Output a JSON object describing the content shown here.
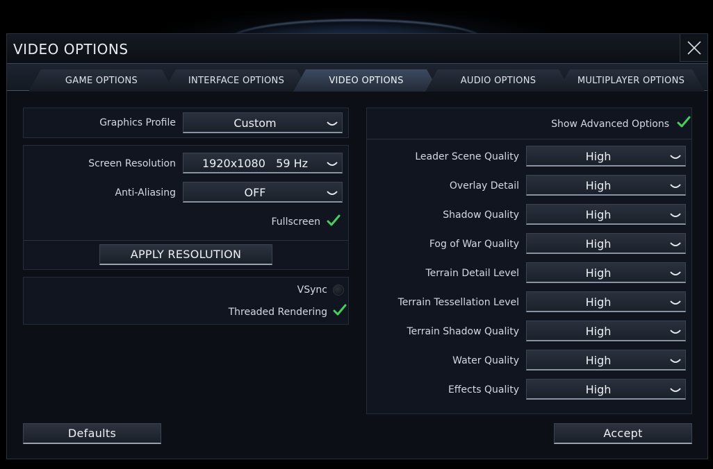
{
  "window": {
    "title": "VIDEO OPTIONS"
  },
  "tabs": [
    {
      "label": "GAME OPTIONS",
      "active": false
    },
    {
      "label": "INTERFACE OPTIONS",
      "active": false
    },
    {
      "label": "VIDEO OPTIONS",
      "active": true
    },
    {
      "label": "AUDIO OPTIONS",
      "active": false
    },
    {
      "label": "MULTIPLAYER OPTIONS",
      "active": false
    }
  ],
  "left": {
    "graphics_profile": {
      "label": "Graphics Profile",
      "value": "Custom"
    },
    "screen_resolution": {
      "label": "Screen Resolution",
      "value": "1920x1080   59 Hz"
    },
    "anti_aliasing": {
      "label": "Anti-Aliasing",
      "value": "OFF"
    },
    "fullscreen": {
      "label": "Fullscreen",
      "checked": true
    },
    "apply_label": "APPLY RESOLUTION",
    "vsync": {
      "label": "VSync",
      "checked": false
    },
    "threaded": {
      "label": "Threaded Rendering",
      "checked": true
    }
  },
  "right": {
    "show_advanced": {
      "label": "Show Advanced Options",
      "checked": true
    },
    "rows": [
      {
        "label": "Leader Scene Quality",
        "value": "High"
      },
      {
        "label": "Overlay Detail",
        "value": "High"
      },
      {
        "label": "Shadow Quality",
        "value": "High"
      },
      {
        "label": "Fog of War Quality",
        "value": "High"
      },
      {
        "label": "Terrain Detail Level",
        "value": "High"
      },
      {
        "label": "Terrain Tessellation Level",
        "value": "High"
      },
      {
        "label": "Terrain Shadow Quality",
        "value": "High"
      },
      {
        "label": "Water Quality",
        "value": "High"
      },
      {
        "label": "Effects Quality",
        "value": "High"
      }
    ]
  },
  "footer": {
    "defaults_label": "Defaults",
    "accept_label": "Accept"
  },
  "colors": {
    "check": "#3fd35a",
    "accent": "#8a93a2"
  },
  "icons": {
    "close": "close-icon",
    "dropdown": "chevron-down-icon",
    "check": "checkmark-icon"
  }
}
